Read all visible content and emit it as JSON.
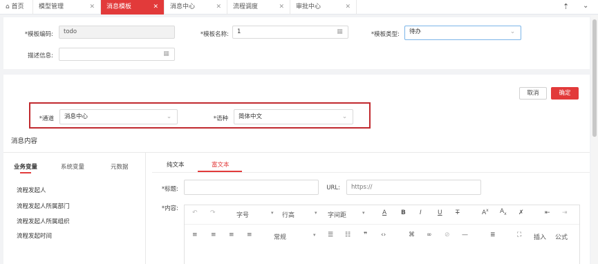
{
  "tabs": [
    {
      "label": "首页",
      "icon": "home-icon"
    },
    {
      "label": "模型管理"
    },
    {
      "label": "消息模板",
      "active": true
    },
    {
      "label": "消息中心"
    },
    {
      "label": "流程调度"
    },
    {
      "label": "审批中心"
    }
  ],
  "toolbar_icons": [
    "upload-icon",
    "chevron-down-icon"
  ],
  "form": {
    "code_label": "*模板编码:",
    "code_value": "todo",
    "name_label": "*模板名称:",
    "name_value": "1",
    "type_label": "*模板类型:",
    "type_value": "待办",
    "desc_label": "描述信息:",
    "desc_value": ""
  },
  "actions": {
    "cancel": "取消",
    "confirm": "确定"
  },
  "channel": {
    "channel_label": "*通道",
    "channel_value": "消息中心",
    "lang_label": "*语种",
    "lang_value": "简体中文"
  },
  "section_title": "消息内容",
  "var_tabs": [
    "业务变量",
    "系统变量",
    "元数据"
  ],
  "variables": [
    "流程发起人",
    "流程发起人所属部门",
    "流程发起人所属组织",
    "流程发起时间"
  ],
  "editor_tabs": [
    "纯文本",
    "富文本"
  ],
  "editor": {
    "title_label": "*标题:",
    "title_value": "",
    "url_label": "URL:",
    "url_placeholder": "https://",
    "content_label": "*内容:"
  },
  "rte_row1": {
    "font_size": "字号",
    "line_height": "行高",
    "letter_spacing": "字间距"
  },
  "rte_row2": {
    "paragraph": "常规",
    "insert": "插入",
    "formula": "公式"
  },
  "colors": {
    "accent": "#e23a3a",
    "highlight_border": "#c0282d",
    "select_border": "#7ab4e8"
  }
}
